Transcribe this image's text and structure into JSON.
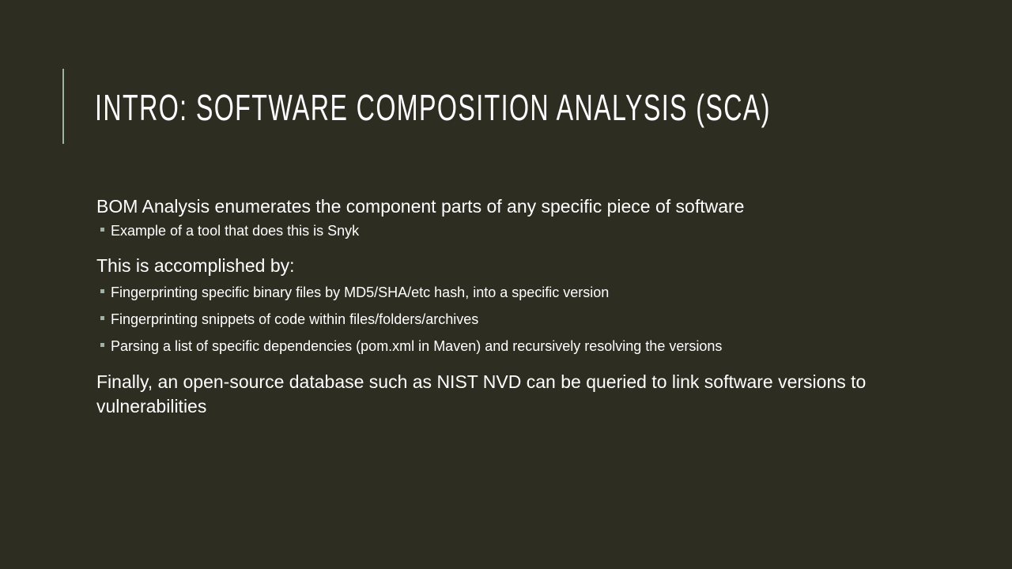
{
  "title": "Intro: Software Composition Analysis (SCA)",
  "sections": [
    {
      "text": "BOM Analysis enumerates the component parts of any specific piece of software",
      "bullets": [
        "Example of a tool that does this is Snyk"
      ]
    },
    {
      "text": "This is accomplished by:",
      "bullets": [
        "Fingerprinting specific binary files by MD5/SHA/etc hash, into a specific version",
        "Fingerprinting snippets of code within files/folders/archives",
        "Parsing a list of specific dependencies (pom.xml in Maven) and recursively resolving the versions"
      ]
    },
    {
      "text": "Finally, an open-source database such as NIST NVD can be queried to link software versions to vulnerabilities",
      "bullets": []
    }
  ],
  "colors": {
    "background": "#2e2d22",
    "accent": "#9fb3a4",
    "text": "#ffffff"
  }
}
